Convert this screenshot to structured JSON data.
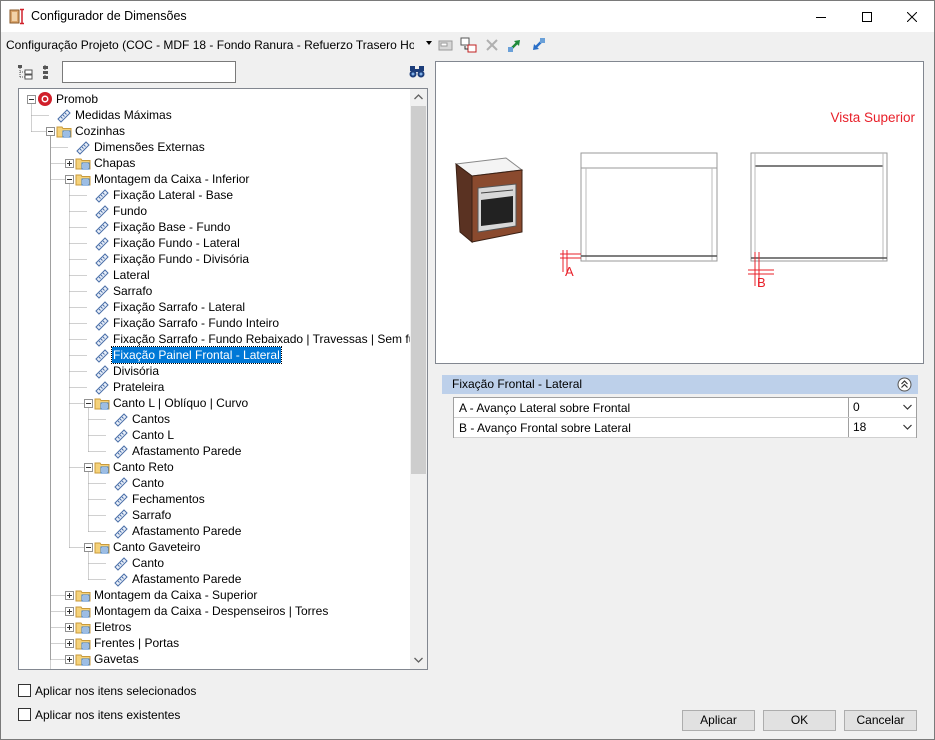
{
  "window": {
    "title": "Configurador de Dimensões",
    "title_icon": "ruler-book-icon"
  },
  "toolbar": {
    "config_value": "Configuração Projeto (COC - MDF 18 - Fondo Ranura - Refuerzo Trasero Horizontal)",
    "icons": [
      "save-icon",
      "save-as-icon",
      "delete-icon",
      "import-icon",
      "export-icon"
    ]
  },
  "tree": {
    "search_value": "",
    "items": [
      {
        "label": "Promob",
        "level": 0,
        "type": "root",
        "expander": "minus"
      },
      {
        "label": "Medidas Máximas",
        "level": 1,
        "type": "leaf"
      },
      {
        "label": "Cozinhas",
        "level": 1,
        "type": "folder",
        "expander": "minus"
      },
      {
        "label": "Dimensões Externas",
        "level": 2,
        "type": "leaf"
      },
      {
        "label": "Chapas",
        "level": 2,
        "type": "folder",
        "expander": "plus"
      },
      {
        "label": "Montagem da Caixa - Inferior",
        "level": 2,
        "type": "folder",
        "expander": "minus"
      },
      {
        "label": "Fixação Lateral - Base",
        "level": 3,
        "type": "leaf"
      },
      {
        "label": "Fundo",
        "level": 3,
        "type": "leaf"
      },
      {
        "label": "Fixação Base - Fundo",
        "level": 3,
        "type": "leaf"
      },
      {
        "label": "Fixação Fundo - Lateral",
        "level": 3,
        "type": "leaf"
      },
      {
        "label": "Fixação Fundo - Divisória",
        "level": 3,
        "type": "leaf"
      },
      {
        "label": "Lateral",
        "level": 3,
        "type": "leaf"
      },
      {
        "label": "Sarrafo",
        "level": 3,
        "type": "leaf"
      },
      {
        "label": "Fixação Sarrafo - Lateral",
        "level": 3,
        "type": "leaf"
      },
      {
        "label": "Fixação Sarrafo - Fundo Inteiro",
        "level": 3,
        "type": "leaf"
      },
      {
        "label": "Fixação Sarrafo - Fundo Rebaixado | Travessas | Sem fundo",
        "level": 3,
        "type": "leaf"
      },
      {
        "label": "Fixação Painel Frontal - Lateral",
        "level": 3,
        "type": "leaf",
        "selected": true
      },
      {
        "label": "Divisória",
        "level": 3,
        "type": "leaf"
      },
      {
        "label": "Prateleira",
        "level": 3,
        "type": "leaf"
      },
      {
        "label": "Canto L | Oblíquo | Curvo",
        "level": 3,
        "type": "folder",
        "expander": "minus"
      },
      {
        "label": "Cantos",
        "level": 4,
        "type": "leaf"
      },
      {
        "label": "Canto L",
        "level": 4,
        "type": "leaf"
      },
      {
        "label": "Afastamento Parede",
        "level": 4,
        "type": "leaf"
      },
      {
        "label": "Canto Reto",
        "level": 3,
        "type": "folder",
        "expander": "minus"
      },
      {
        "label": "Canto",
        "level": 4,
        "type": "leaf"
      },
      {
        "label": "Fechamentos",
        "level": 4,
        "type": "leaf"
      },
      {
        "label": "Sarrafo",
        "level": 4,
        "type": "leaf"
      },
      {
        "label": "Afastamento Parede",
        "level": 4,
        "type": "leaf"
      },
      {
        "label": "Canto Gaveteiro",
        "level": 3,
        "type": "folder",
        "expander": "minus"
      },
      {
        "label": "Canto",
        "level": 4,
        "type": "leaf"
      },
      {
        "label": "Afastamento Parede",
        "level": 4,
        "type": "leaf"
      },
      {
        "label": "Montagem da Caixa - Superior",
        "level": 2,
        "type": "folder",
        "expander": "plus"
      },
      {
        "label": "Montagem da Caixa - Despenseiros | Torres",
        "level": 2,
        "type": "folder",
        "expander": "plus"
      },
      {
        "label": "Eletros",
        "level": 2,
        "type": "folder",
        "expander": "plus"
      },
      {
        "label": "Frentes | Portas",
        "level": 2,
        "type": "folder",
        "expander": "plus"
      },
      {
        "label": "Gavetas",
        "level": 2,
        "type": "folder",
        "expander": "plus"
      }
    ]
  },
  "preview": {
    "view_label": "Vista Superior",
    "label_a": "A",
    "label_b": "B",
    "accent_color": "#e8202a"
  },
  "properties": {
    "group_title": "Fixação Frontal - Lateral",
    "rows": [
      {
        "name": "A - Avanço Lateral sobre Frontal",
        "value": "0"
      },
      {
        "name": "B - Avanço Frontal sobre Lateral",
        "value": "18"
      }
    ]
  },
  "options": {
    "apply_selected": {
      "label": "Aplicar nos itens selecionados",
      "checked": false
    },
    "apply_existing": {
      "label": "Aplicar nos itens existentes",
      "checked": false
    }
  },
  "buttons": {
    "apply": "Aplicar",
    "ok": "OK",
    "cancel": "Cancelar"
  }
}
